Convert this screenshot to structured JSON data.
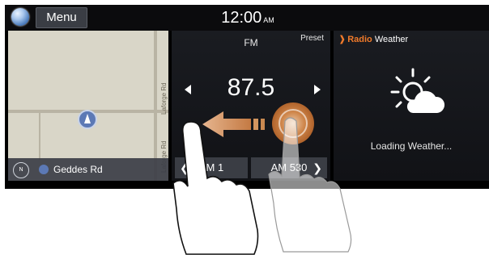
{
  "statusbar": {
    "menu_label": "Menu",
    "clock_time": "12:00",
    "clock_ampm": "AM"
  },
  "map": {
    "street_label_1": "Laforge Rd",
    "street_label_2": "Laforge Rd",
    "compass_label": "N",
    "current_street": "Geddes Rd"
  },
  "radio": {
    "band": "FM",
    "preset_label": "Preset",
    "frequency": "87.5",
    "preset_1": "XM 1",
    "preset_2": "AM 530"
  },
  "weather": {
    "title_radio": "Radio",
    "title_weather": "Weather",
    "status": "Loading Weather..."
  },
  "colors": {
    "accent": "#f07a2a",
    "panel": "#1b1d22",
    "map_bg": "#d9d6c8"
  }
}
